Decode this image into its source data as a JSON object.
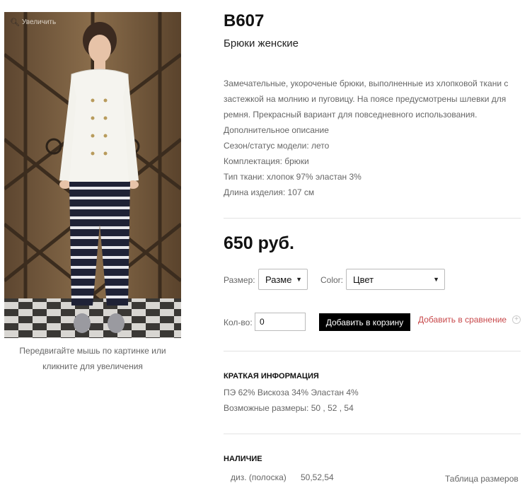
{
  "photo": {
    "zoom_label": "Увеличить",
    "caption": "Передвигайте мышь по картинке или кликните для увеличения"
  },
  "product": {
    "sku": "B607",
    "title": "Брюки женские",
    "description": [
      "Замечательные, укороченые брюки, выполненные из хлопковой ткани с",
      "застежкой на молнию и пуговицу. На поясе предусмотрены шлевки для",
      "ремня. Прекрасный вариант для повседневного использования.",
      "Дополнительное описание",
      "Сезон/статус модели: лето",
      "Комплектация: брюки",
      "Тип ткани: хлопок 97% эластан 3%",
      "Длина изделия: 107 см"
    ],
    "price": "650 руб."
  },
  "options": {
    "size_label": "Размер:",
    "size_value": "Размер",
    "color_label": "Color:",
    "color_value": "Цвет"
  },
  "cart": {
    "qty_label": "Кол-во:",
    "qty_value": "0",
    "add_button": "Добавить в корзину",
    "compare_link": "Добавить в сравнение",
    "compare_icon": "+"
  },
  "short_info": {
    "heading": "КРАТКАЯ ИНФОРМАЦИЯ",
    "composition": "ПЭ 62% Вискоза 34% Эластан 4%",
    "sizes": "Возможные размеры: 50 , 52 , 54"
  },
  "availability": {
    "heading": "НАЛИЧИЕ",
    "variant": "диз. (полоска)",
    "sizes": "50,52,54",
    "size_chart_link": "Таблица размеров"
  }
}
